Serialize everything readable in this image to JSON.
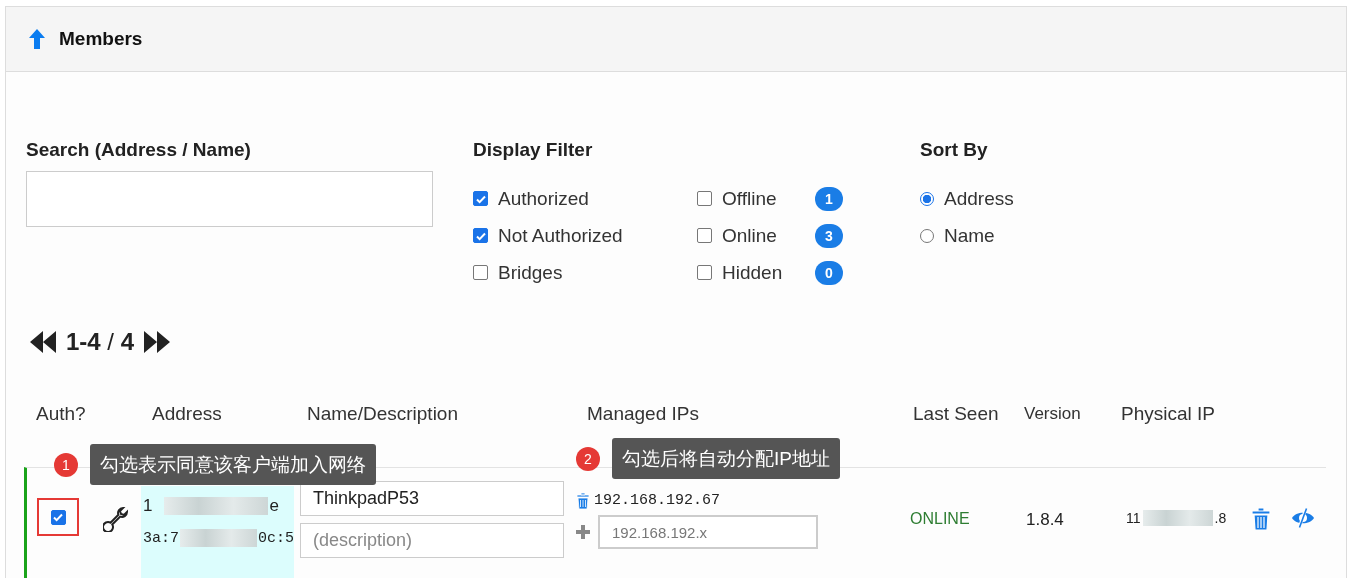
{
  "header": {
    "title": "Members"
  },
  "search": {
    "label": "Search (Address / Name)"
  },
  "display_filter": {
    "label": "Display Filter",
    "rows": [
      {
        "left": {
          "label": "Authorized",
          "checked": true
        },
        "right": {
          "label": "Offline",
          "checked": false
        },
        "count": "1"
      },
      {
        "left": {
          "label": "Not Authorized",
          "checked": true
        },
        "right": {
          "label": "Online",
          "checked": false
        },
        "count": "3"
      },
      {
        "left": {
          "label": "Bridges",
          "checked": false
        },
        "right": {
          "label": "Hidden",
          "checked": false
        },
        "count": "0"
      }
    ]
  },
  "sort_by": {
    "label": "Sort By",
    "options": [
      {
        "label": "Address",
        "selected": true
      },
      {
        "label": "Name",
        "selected": false
      }
    ]
  },
  "pagination": {
    "range": "**1-4** / **4**"
  },
  "table": {
    "columns": [
      "Auth?",
      "Address",
      "Name/Description",
      "Managed IPs",
      "Last Seen",
      "Version",
      "Physical IP"
    ],
    "rows": [
      {
        "authorized": true,
        "highlighted": true,
        "address": {
          "start": "1",
          "end": "e"
        },
        "mac": {
          "start": "3a:7",
          "end": "0c:5"
        },
        "name": "ThinkpadP53",
        "description_placeholder": "(description)",
        "managed_ips": [
          "192.168.192.67"
        ],
        "ip_placeholder": "192.168.192.x",
        "status": "ONLINE",
        "version": "1.8.4",
        "physical_ip": {
          "start": "11",
          "end": ".8"
        }
      }
    ]
  },
  "annotations": [
    {
      "number": "1",
      "text": "勾选表示同意该客户端加入网络"
    },
    {
      "number": "2",
      "text": "勾选后将自动分配IP地址"
    }
  ]
}
